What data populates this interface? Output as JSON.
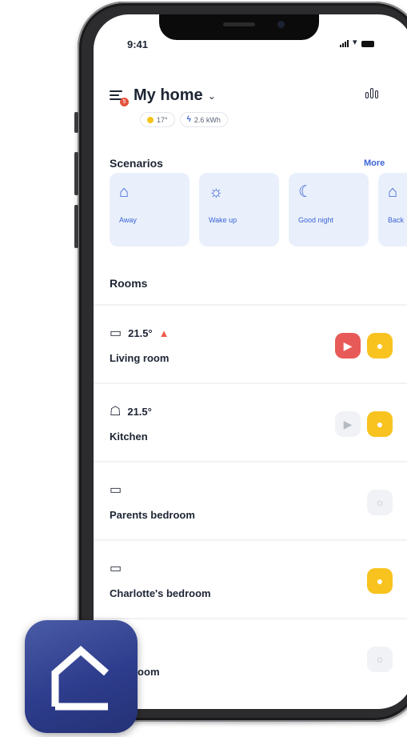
{
  "status_bar": {
    "time": "9:41"
  },
  "header": {
    "home_name": "My home",
    "notification_count": "5"
  },
  "chips": {
    "temperature": "17°",
    "energy": "2.6 kWh"
  },
  "scenarios": {
    "title": "Scenarios",
    "more_label": "More",
    "items": [
      {
        "label": "Away",
        "icon": "house-exit-icon"
      },
      {
        "label": "Wake up",
        "icon": "sun-icon"
      },
      {
        "label": "Good night",
        "icon": "moon-icon"
      },
      {
        "label": "Back",
        "icon": "house-enter-icon"
      }
    ]
  },
  "rooms": {
    "title": "Rooms",
    "items": [
      {
        "name": "Living room",
        "temp": "21.5°",
        "icon": "sofa-icon",
        "heating": true,
        "media": "on",
        "light": "on"
      },
      {
        "name": "Kitchen",
        "temp": "21.5°",
        "icon": "pot-icon",
        "heating": false,
        "media": "off",
        "light": "on"
      },
      {
        "name": "Parents bedroom",
        "temp": "",
        "icon": "bed-icon",
        "heating": false,
        "media": "none",
        "light": "off"
      },
      {
        "name": "Charlotte's bedroom",
        "temp": "",
        "icon": "bed-icon",
        "heating": false,
        "media": "none",
        "light": "on"
      },
      {
        "name": "room",
        "temp": "",
        "icon": "",
        "heating": false,
        "media": "none",
        "light": "off"
      }
    ]
  },
  "colors": {
    "accent": "#3c64d6",
    "scenario_card": "#e9f0fb",
    "media_on": "#e85a57",
    "light_on": "#f8c31f",
    "badge": "#e5533d",
    "app_icon": "#2d3c8c"
  }
}
